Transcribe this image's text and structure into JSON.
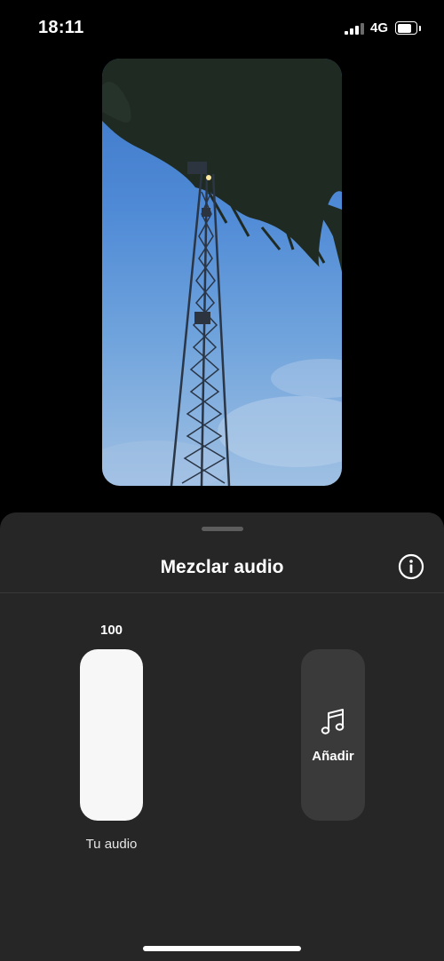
{
  "status_bar": {
    "time": "18:11",
    "network": "4G",
    "signal_icon": "cellular-signal-icon",
    "battery_icon": "battery-icon"
  },
  "preview": {
    "description_icon": "video-preview-image"
  },
  "sheet": {
    "title": "Mezclar audio",
    "info_icon": "info-icon",
    "audio_slider": {
      "value": "100",
      "level": 1.0,
      "label": "Tu audio"
    },
    "add_button": {
      "icon": "music-note-icon",
      "label": "Añadir"
    }
  },
  "colors": {
    "background": "#000000",
    "sheet": "#262626",
    "slider_fill": "#f7f7f7",
    "add_button": "#3a3a3a"
  }
}
